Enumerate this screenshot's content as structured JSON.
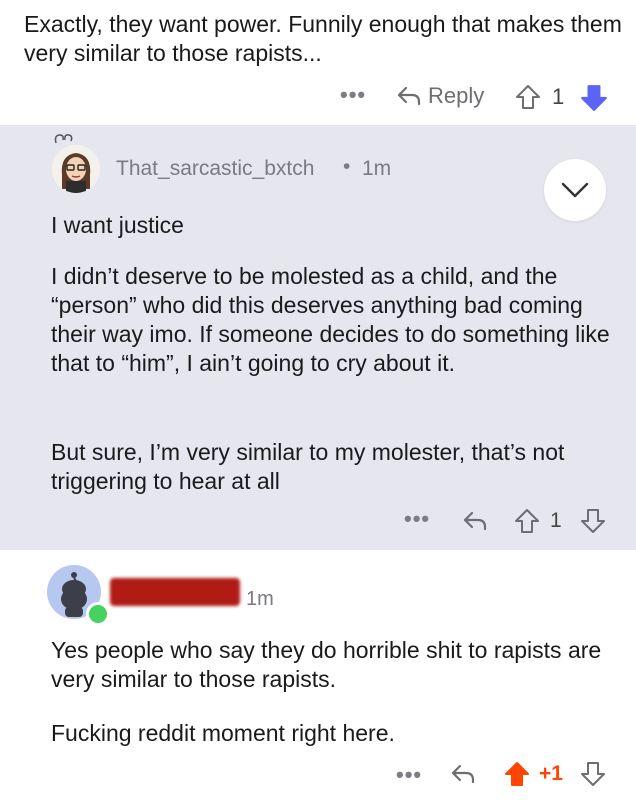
{
  "top_comment": {
    "body": "Exactly, they want power. Funnily enough that makes them very similar to those rapists...",
    "actions": {
      "more": "•••",
      "reply_label": "Reply",
      "score": "1"
    }
  },
  "reply_comment": {
    "username": "That_sarcastic_bxtch",
    "separator": "•",
    "time": "1m",
    "paragraphs": [
      "I want justice",
      "I didn’t deserve to be molested as a child, and the “person” who did this deserves anything bad coming their way imo. If someone decides to do something like that to “him”, I ain’t going to cry about it.",
      "But sure, I’m very similar to my molester, that’s not triggering to hear at all"
    ],
    "actions": {
      "more": "•••",
      "score": "1"
    }
  },
  "bottom_comment": {
    "time": "1m",
    "paragraphs": [
      "Yes people who say they do horrible shit to rapists are very similar to those rapists.",
      "Fucking reddit moment right here."
    ],
    "actions": {
      "more": "•••",
      "score": "+1"
    }
  },
  "colors": {
    "highlight_bg": "#e6e6ef",
    "upvote_orange": "#ff4500",
    "downvote_blue": "#5a65f5",
    "online_green": "#46d160",
    "redaction": "#b01b15"
  },
  "icons": [
    "reply-icon",
    "upvote-icon",
    "downvote-icon",
    "chevron-down-icon",
    "more-icon"
  ]
}
